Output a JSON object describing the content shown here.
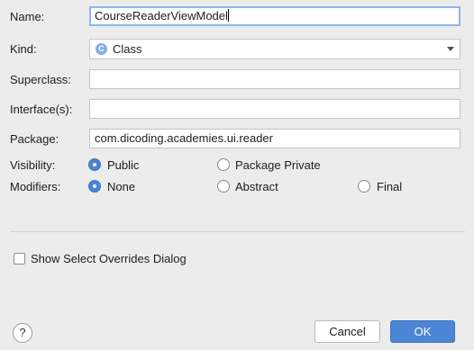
{
  "form": {
    "name_label": "Name:",
    "name_value": "CourseReaderViewModel",
    "kind_label": "Kind:",
    "kind_icon_letter": "C",
    "kind_value": "Class",
    "superclass_label": "Superclass:",
    "superclass_value": "",
    "interfaces_label": "Interface(s):",
    "interfaces_value": "",
    "package_label": "Package:",
    "package_value": "com.dicoding.academies.ui.reader",
    "visibility_label": "Visibility:",
    "visibility_options": [
      "Public",
      "Package Private"
    ],
    "visibility_selected": "Public",
    "modifiers_label": "Modifiers:",
    "modifiers_options": [
      "None",
      "Abstract",
      "Final"
    ],
    "modifiers_selected": "None",
    "show_overrides_label": "Show Select Overrides Dialog",
    "show_overrides_checked": false
  },
  "footer": {
    "help_label": "?",
    "cancel_label": "Cancel",
    "ok_label": "OK"
  },
  "colors": {
    "accent": "#4b86d4",
    "background": "#ececec"
  }
}
